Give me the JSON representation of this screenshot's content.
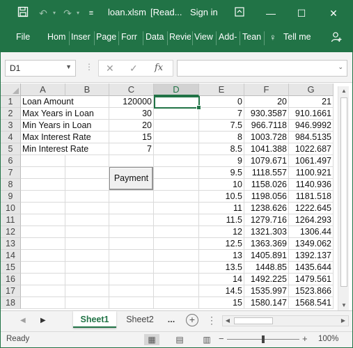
{
  "titlebar": {
    "filename": "loan.xlsm",
    "mode": "[Read...",
    "signin": "Sign in",
    "save_icon": "save-icon",
    "undo_icon": "undo-icon",
    "redo_icon": "redo-icon",
    "customize_icon": "customize-arrow-icon",
    "ribbon_display_icon": "ribbon-display-icon"
  },
  "ribbon": {
    "tabs": [
      "File",
      "Hom",
      "Inser",
      "Page",
      "Forr",
      "Data",
      "Revie",
      "View",
      "Add-",
      "Tean"
    ],
    "tellme": "Tell me",
    "share_icon": "share-icon"
  },
  "formula_bar": {
    "name_box": "D1",
    "fx": "fx",
    "formula": ""
  },
  "columns": [
    "A",
    "B",
    "C",
    "D",
    "E",
    "F",
    "G"
  ],
  "selected_column": "D",
  "rows": [
    {
      "n": "1",
      "a": "Loan Amount",
      "c": "120000",
      "e": "0",
      "f": "20",
      "g": "21"
    },
    {
      "n": "2",
      "a": "Max Years in Loan",
      "c": "30",
      "e": "7",
      "f": "930.3587",
      "g": "910.1661"
    },
    {
      "n": "3",
      "a": "Min Years in Loan",
      "c": "20",
      "e": "7.5",
      "f": "966.7118",
      "g": "946.9992"
    },
    {
      "n": "4",
      "a": "Max Interest Rate",
      "c": "15",
      "e": "8",
      "f": "1003.728",
      "g": "984.5135"
    },
    {
      "n": "5",
      "a": "Min Interest Rate",
      "c": "7",
      "e": "8.5",
      "f": "1041.388",
      "g": "1022.687"
    },
    {
      "n": "6",
      "a": "",
      "c": "",
      "e": "9",
      "f": "1079.671",
      "g": "1061.497"
    },
    {
      "n": "7",
      "a": "",
      "c": "",
      "e": "9.5",
      "f": "1118.557",
      "g": "1100.921"
    },
    {
      "n": "8",
      "a": "",
      "c": "",
      "e": "10",
      "f": "1158.026",
      "g": "1140.936"
    },
    {
      "n": "9",
      "a": "",
      "c": "",
      "e": "10.5",
      "f": "1198.056",
      "g": "1181.518"
    },
    {
      "n": "10",
      "a": "",
      "c": "",
      "e": "11",
      "f": "1238.626",
      "g": "1222.645"
    },
    {
      "n": "11",
      "a": "",
      "c": "",
      "e": "11.5",
      "f": "1279.716",
      "g": "1264.293"
    },
    {
      "n": "12",
      "a": "",
      "c": "",
      "e": "12",
      "f": "1321.303",
      "g": "1306.44"
    },
    {
      "n": "13",
      "a": "",
      "c": "",
      "e": "12.5",
      "f": "1363.369",
      "g": "1349.062"
    },
    {
      "n": "14",
      "a": "",
      "c": "",
      "e": "13",
      "f": "1405.891",
      "g": "1392.137"
    },
    {
      "n": "15",
      "a": "",
      "c": "",
      "e": "13.5",
      "f": "1448.85",
      "g": "1435.644"
    },
    {
      "n": "16",
      "a": "",
      "c": "",
      "e": "14",
      "f": "1492.225",
      "g": "1479.561"
    },
    {
      "n": "17",
      "a": "",
      "c": "",
      "e": "14.5",
      "f": "1535.997",
      "g": "1523.866"
    },
    {
      "n": "18",
      "a": "",
      "c": "",
      "e": "15",
      "f": "1580.147",
      "g": "1568.541"
    }
  ],
  "payment_button": "Payment",
  "sheets": {
    "active": "Sheet1",
    "other": "Sheet2",
    "more": "..."
  },
  "status": {
    "ready": "Ready",
    "zoom": "100%",
    "zoom_out": "−",
    "zoom_in": "+"
  },
  "colors": {
    "excel_green": "#217346"
  }
}
